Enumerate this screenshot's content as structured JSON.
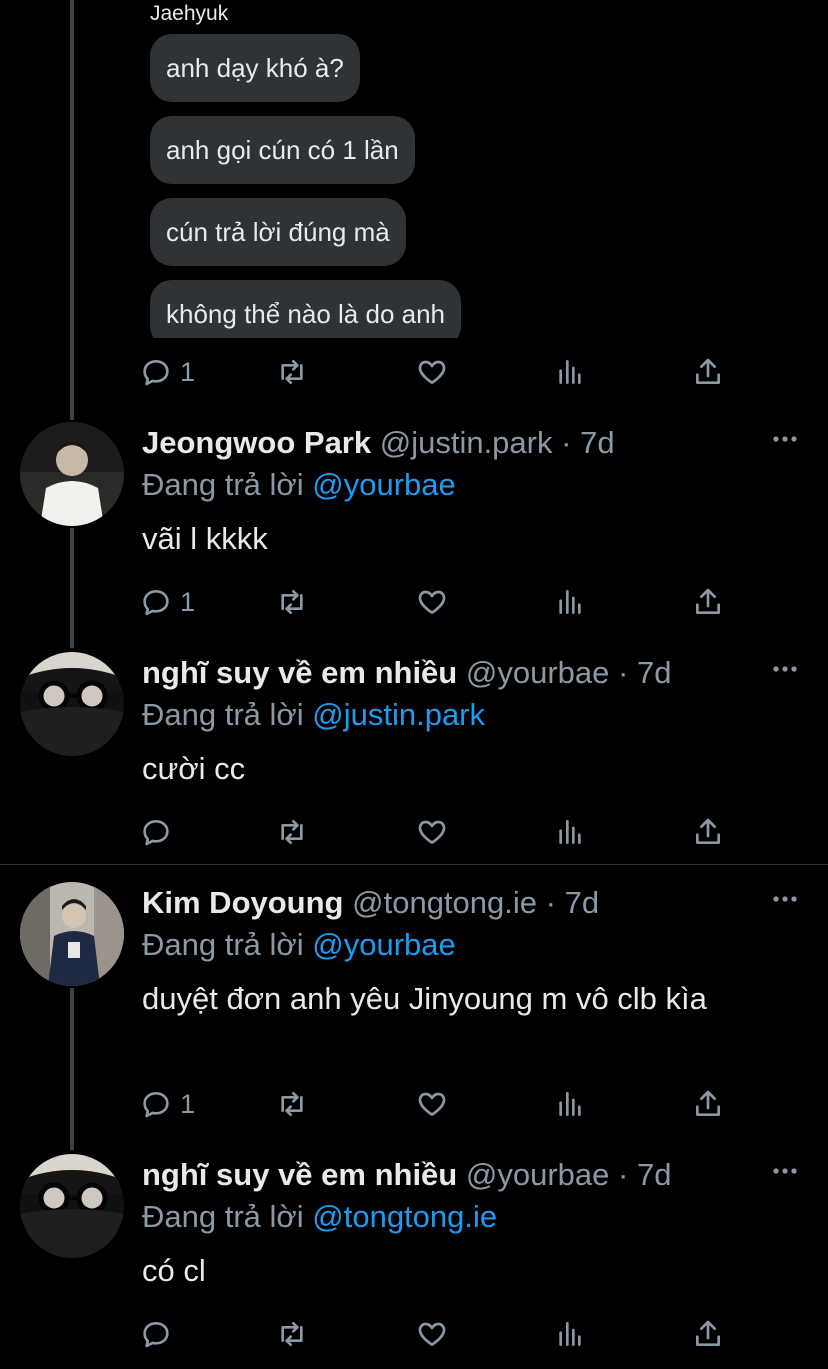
{
  "chat": {
    "sender": "Jaehyuk",
    "messages": [
      "anh dạy khó à?",
      "anh gọi cún có 1 lần",
      "cún trả lời đúng mà",
      "không thể nào là do anh"
    ]
  },
  "quoted_tweet_actions": {
    "reply_count": "1"
  },
  "tweets": [
    {
      "name": "Jeongwoo Park",
      "handle": "@justin.park",
      "dot": "·",
      "time": "7d",
      "replying_prefix": "Đang trả lời",
      "replying_to": "@yourbae",
      "text": "vãi l kkkk",
      "reply_count": "1"
    },
    {
      "name": "nghĩ suy về em nhiều",
      "handle": "@yourbae",
      "dot": "·",
      "time": "7d",
      "replying_prefix": "Đang trả lời",
      "replying_to": "@justin.park",
      "text": "cười cc",
      "reply_count": ""
    },
    {
      "name": "Kim Doyoung",
      "handle": "@tongtong.ie",
      "dot": "·",
      "time": "7d",
      "replying_prefix": "Đang trả lời",
      "replying_to": "@yourbae",
      "text": "duyệt đơn anh yêu Jinyoung m vô clb kìa",
      "reply_count": "1"
    },
    {
      "name": "nghĩ suy về em nhiều",
      "handle": "@yourbae",
      "dot": "·",
      "time": "7d",
      "replying_prefix": "Đang trả lời",
      "replying_to": "@tongtong.ie",
      "text": "có cl",
      "reply_count": ""
    }
  ],
  "icons": {
    "reply": "reply-icon",
    "retweet": "retweet-icon",
    "like": "heart-icon",
    "views": "views-icon",
    "share": "share-icon",
    "more": "more-icon"
  },
  "colors": {
    "background": "#000000",
    "text": "#e7e9ea",
    "muted": "#8b98a5",
    "link": "#1d9bf0",
    "bubble": "#2f3336"
  }
}
